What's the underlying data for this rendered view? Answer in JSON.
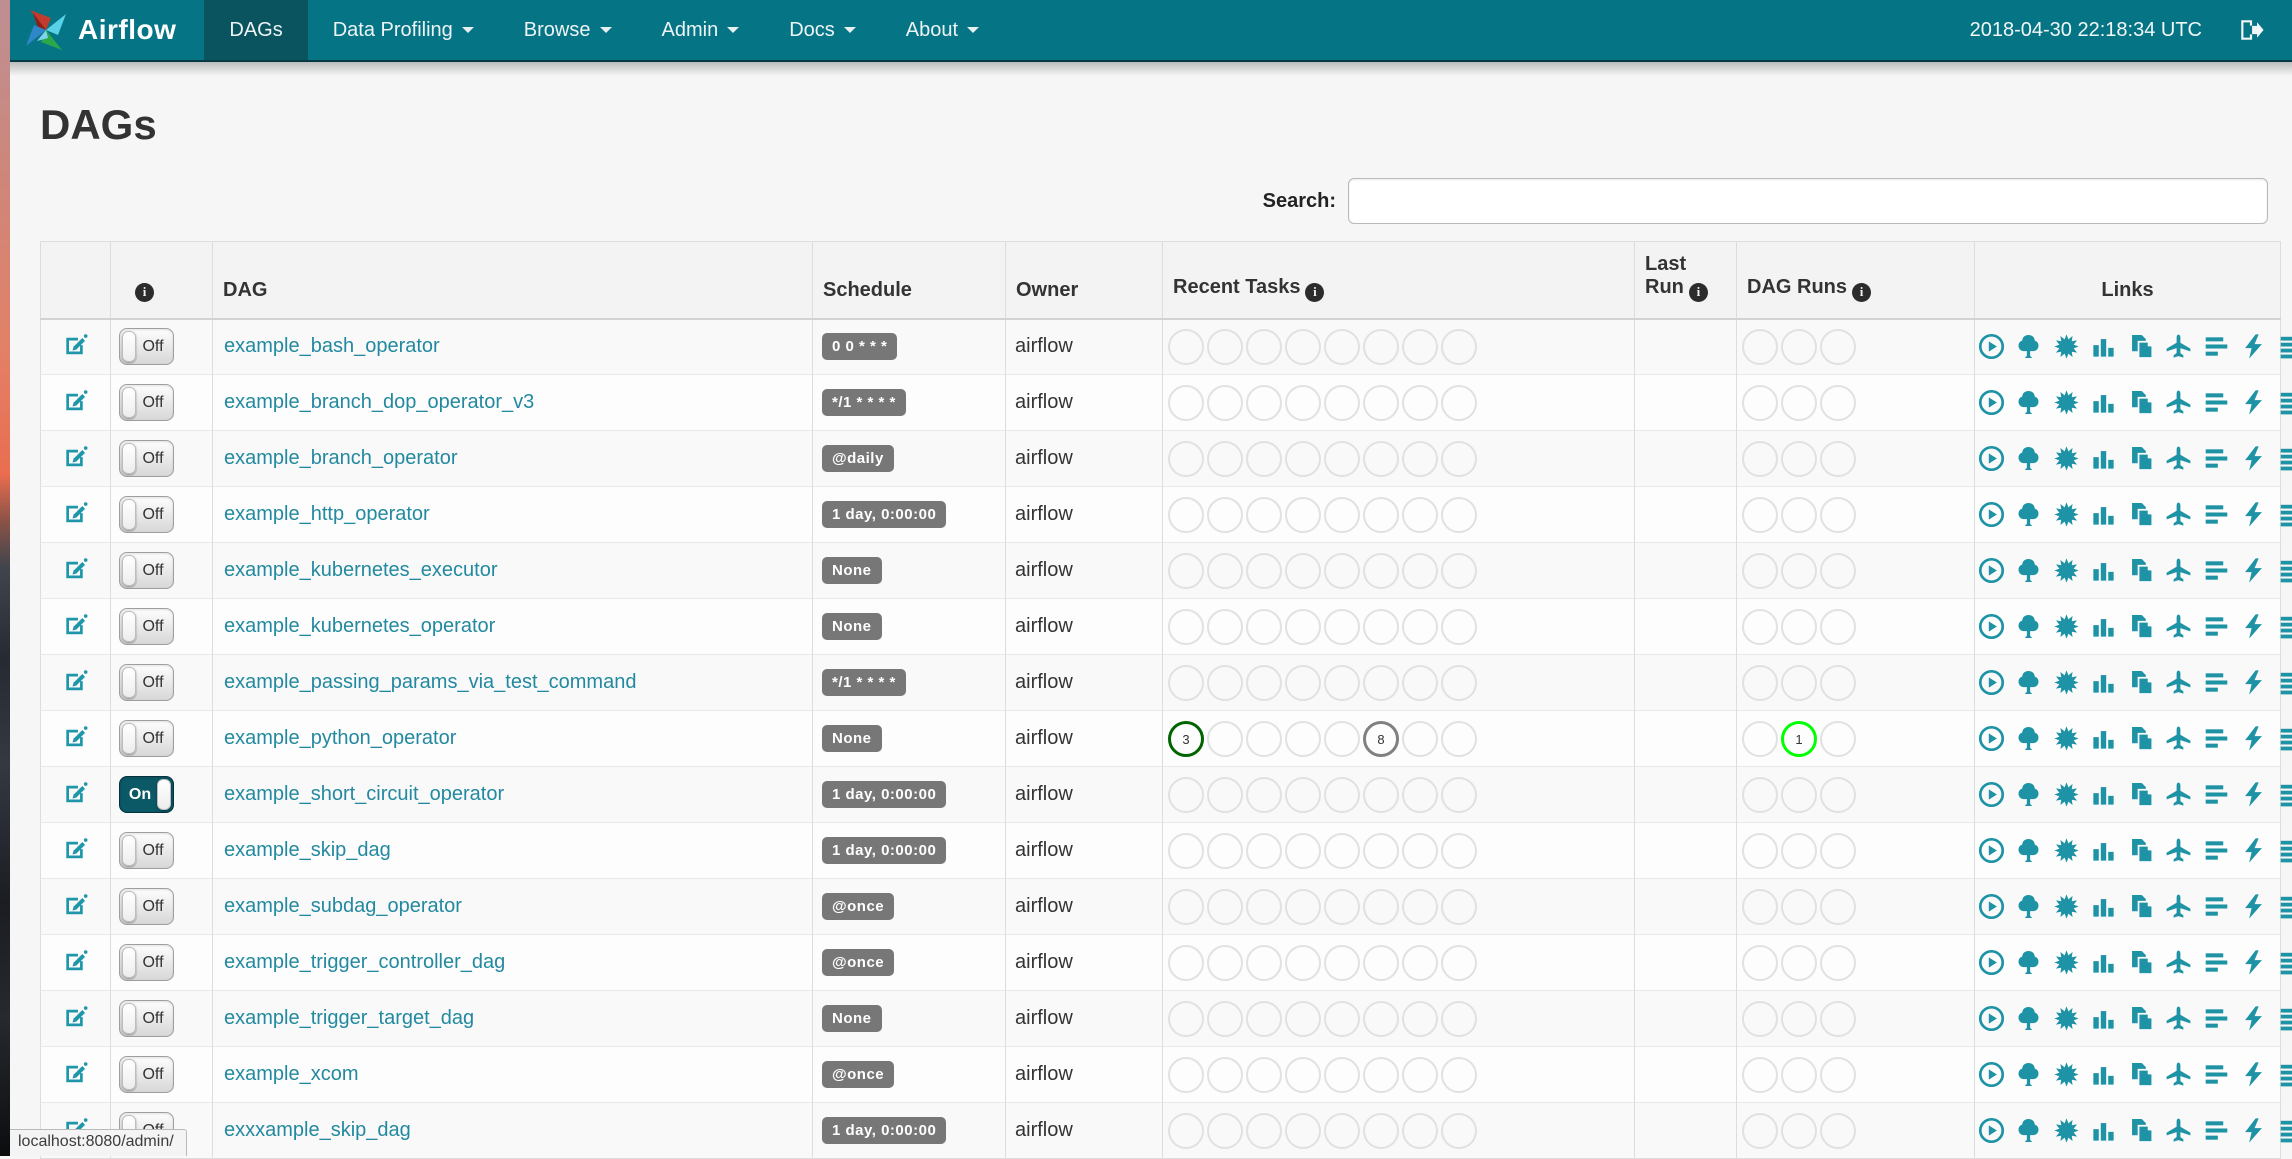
{
  "navbar": {
    "brand": "Airflow",
    "items": [
      {
        "label": "DAGs",
        "active": true,
        "caret": false
      },
      {
        "label": "Data Profiling",
        "active": false,
        "caret": true
      },
      {
        "label": "Browse",
        "active": false,
        "caret": true
      },
      {
        "label": "Admin",
        "active": false,
        "caret": true
      },
      {
        "label": "Docs",
        "active": false,
        "caret": true
      },
      {
        "label": "About",
        "active": false,
        "caret": true
      }
    ],
    "clock": "2018-04-30 22:18:34 UTC",
    "logout_icon": "sign-out-icon"
  },
  "page": {
    "title": "DAGs",
    "search_label": "Search:",
    "search_value": "",
    "status_bar": "localhost:8080/admin/"
  },
  "table": {
    "headers": {
      "dag": "DAG",
      "schedule": "Schedule",
      "owner": "Owner",
      "recent_tasks": "Recent Tasks",
      "last_run": "Last Run",
      "dag_runs": "DAG Runs",
      "links": "Links"
    },
    "recent_task_slots": 8,
    "dag_run_slots": 3,
    "state_colors": {
      "success": "#006400",
      "running": "#00ff00",
      "queued": "#808080"
    },
    "links_icons": [
      "trigger-dag-play-icon",
      "tree-view-icon",
      "graph-view-icon",
      "task-duration-icon",
      "task-tries-icon",
      "landing-times-icon",
      "gantt-icon",
      "code-icon",
      "logs-icon",
      "refresh-icon"
    ],
    "toggle_states": {
      "on": "On",
      "off": "Off"
    },
    "rows": [
      {
        "toggle": "Off",
        "dag": "example_bash_operator",
        "schedule": "0 0 * * *",
        "owner": "airflow",
        "recent_tasks": [],
        "dag_runs": []
      },
      {
        "toggle": "Off",
        "dag": "example_branch_dop_operator_v3",
        "schedule": "*/1 * * * *",
        "owner": "airflow",
        "recent_tasks": [],
        "dag_runs": []
      },
      {
        "toggle": "Off",
        "dag": "example_branch_operator",
        "schedule": "@daily",
        "owner": "airflow",
        "recent_tasks": [],
        "dag_runs": []
      },
      {
        "toggle": "Off",
        "dag": "example_http_operator",
        "schedule": "1 day, 0:00:00",
        "owner": "airflow",
        "recent_tasks": [],
        "dag_runs": []
      },
      {
        "toggle": "Off",
        "dag": "example_kubernetes_executor",
        "schedule": "None",
        "owner": "airflow",
        "recent_tasks": [],
        "dag_runs": []
      },
      {
        "toggle": "Off",
        "dag": "example_kubernetes_operator",
        "schedule": "None",
        "owner": "airflow",
        "recent_tasks": [],
        "dag_runs": []
      },
      {
        "toggle": "Off",
        "dag": "example_passing_params_via_test_command",
        "schedule": "*/1 * * * *",
        "owner": "airflow",
        "recent_tasks": [],
        "dag_runs": []
      },
      {
        "toggle": "Off",
        "dag": "example_python_operator",
        "schedule": "None",
        "owner": "airflow",
        "recent_tasks": [
          {
            "slot": 1,
            "count": 3,
            "state": "success"
          },
          {
            "slot": 6,
            "count": 8,
            "state": "queued"
          }
        ],
        "dag_runs": [
          {
            "slot": 2,
            "count": 1,
            "state": "running"
          }
        ]
      },
      {
        "toggle": "On",
        "dag": "example_short_circuit_operator",
        "schedule": "1 day, 0:00:00",
        "owner": "airflow",
        "recent_tasks": [],
        "dag_runs": []
      },
      {
        "toggle": "Off",
        "dag": "example_skip_dag",
        "schedule": "1 day, 0:00:00",
        "owner": "airflow",
        "recent_tasks": [],
        "dag_runs": []
      },
      {
        "toggle": "Off",
        "dag": "example_subdag_operator",
        "schedule": "@once",
        "owner": "airflow",
        "recent_tasks": [],
        "dag_runs": []
      },
      {
        "toggle": "Off",
        "dag": "example_trigger_controller_dag",
        "schedule": "@once",
        "owner": "airflow",
        "recent_tasks": [],
        "dag_runs": []
      },
      {
        "toggle": "Off",
        "dag": "example_trigger_target_dag",
        "schedule": "None",
        "owner": "airflow",
        "recent_tasks": [],
        "dag_runs": []
      },
      {
        "toggle": "Off",
        "dag": "example_xcom",
        "schedule": "@once",
        "owner": "airflow",
        "recent_tasks": [],
        "dag_runs": []
      },
      {
        "toggle": "Off",
        "dag": "exxxample_skip_dag",
        "schedule": "1 day, 0:00:00",
        "owner": "airflow",
        "recent_tasks": [],
        "dag_runs": []
      }
    ]
  }
}
